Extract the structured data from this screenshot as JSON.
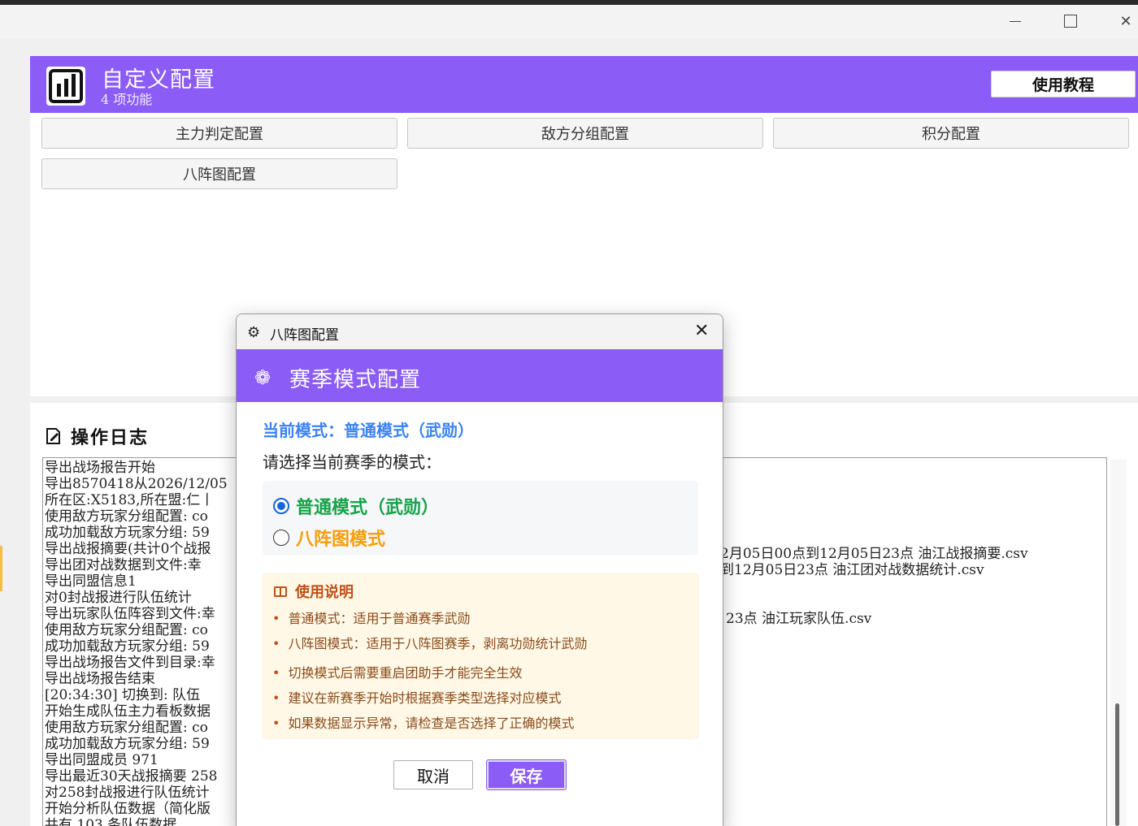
{
  "header": {
    "title": "自定义配置",
    "subtitle": "4 项功能",
    "tutorial_label": "使用教程"
  },
  "features": [
    {
      "label": "主力判定配置"
    },
    {
      "label": "敌方分组配置"
    },
    {
      "label": "积分配置"
    },
    {
      "label": "八阵图配置"
    }
  ],
  "log": {
    "title": "操作日志",
    "lines": [
      "导出战场报告开始",
      "导出8570418从2026/12/05",
      "所在区:X5183,所在盟:仁丨",
      "使用敌方玩家分组配置: co",
      "成功加载敌方玩家分组: 59",
      "导出战报摘要(共计0个战报",
      "导出团对战数据到文件:幸",
      "导出同盟信息1",
      "对0封战报进行队伍统计",
      "导出玩家队伍阵容到文件:幸",
      "使用敌方玩家分组配置: co",
      "成功加载敌方玩家分组: 59",
      "导出战场报告文件到目录:幸",
      "导出战场报告结束",
      "[20:34:30] 切换到: 队伍",
      "开始生成队伍主力看板数据",
      "使用敌方玩家分组配置: co",
      "成功加载敌方玩家分组: 59",
      "导出同盟成员 971",
      "导出最近30天战报摘要 258",
      "对258封战报进行队伍统计",
      "开始分析队伍数据（简化版",
      "共有 103 条队伍数据"
    ],
    "right_fragments": [
      "2月05日00点到12月05日23点 油江战报摘要.csv",
      "到12月05日23点 油江团对战数据统计.csv",
      "23点 油江玩家队伍.csv"
    ]
  },
  "dialog": {
    "window_title": "八阵图配置",
    "banner_title": "赛季模式配置",
    "current_mode": "当前模式：普通模式（武勋）",
    "prompt": "请选择当前赛季的模式：",
    "options": [
      {
        "label": "普通模式（武勋）",
        "selected": true,
        "color": "#16a34a"
      },
      {
        "label": "八阵图模式",
        "selected": false,
        "color": "#f59e0b"
      }
    ],
    "help_title": "使用说明",
    "help_items": [
      "普通模式：适用于普通赛季武勋",
      "八阵图模式：适用于八阵图赛季，剥离功勋统计武勋",
      "切换模式后需要重启团助手才能完全生效",
      "建议在新赛季开始时根据赛季类型选择对应模式",
      "如果数据显示异常，请检查是否选择了正确的模式"
    ],
    "cancel_label": "取消",
    "save_label": "保存"
  },
  "colors": {
    "accent": "#8b5cf6",
    "info_blue": "#3b82f6",
    "help_bg": "#fff8e6",
    "help_text": "#8a4b1c"
  },
  "icons": {
    "logo": "bar-chart-icon",
    "log": "edit-note-icon",
    "dialog": "gear-icon",
    "banner": "flower-gear-icon",
    "help": "book-icon"
  }
}
